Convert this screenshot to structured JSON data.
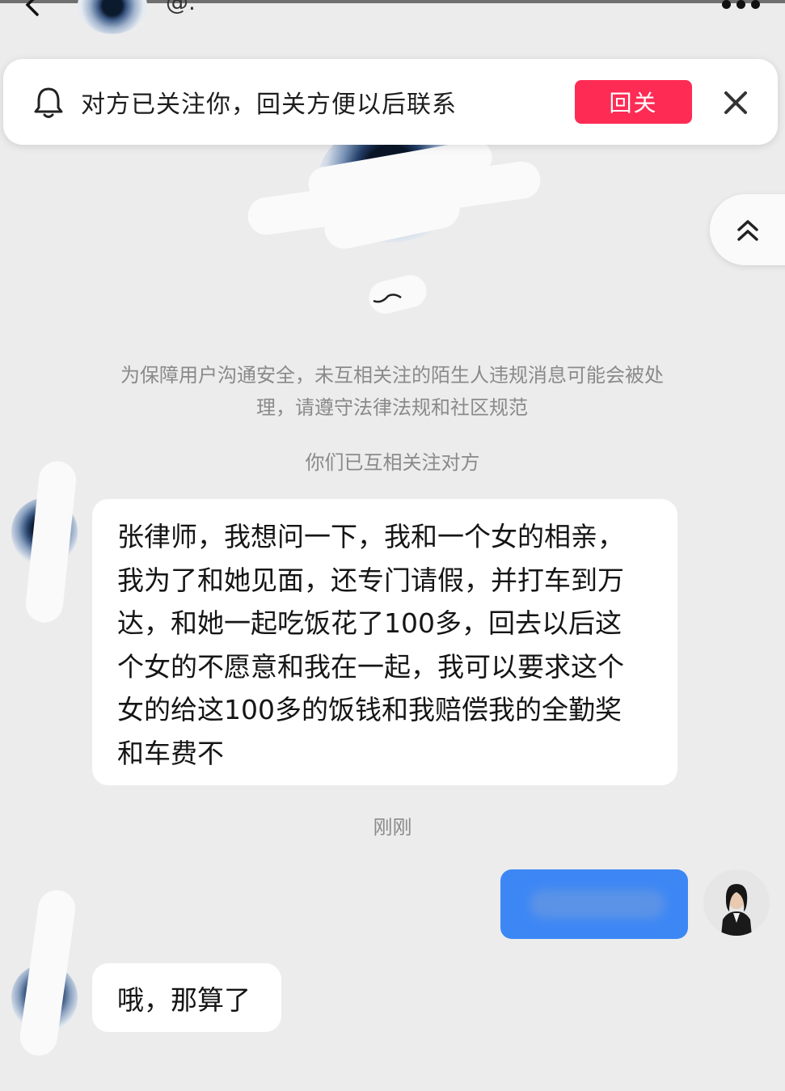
{
  "header": {
    "handle": "@."
  },
  "follow_banner": {
    "text": "对方已关注你，回关方便以后联系",
    "button_label": "回关"
  },
  "notices": {
    "safety_line1": "为保障用户沟通安全，未互相关注的陌生人违规消息可能会被处",
    "safety_line2": "理，请遵守法律法规和社区规范",
    "mutual_follow": "你们已互相关注对方"
  },
  "messages": [
    {
      "sender": "peer",
      "lines": [
        "张律师，我想问一下，我和一个女的相亲，",
        "我为了和她见面，还专门请假，并打车到万",
        "达，和她一起吃饭花了100多，回去以后这",
        "个女的不愿意和我在一起，我可以要求这个",
        "女的给这100多的饭钱和我赔偿我的全勤奖",
        "和车费不"
      ]
    },
    {
      "sender": "system",
      "timestamp": "刚刚"
    },
    {
      "sender": "me"
    },
    {
      "sender": "peer",
      "text": "哦，那算了"
    }
  ],
  "colors": {
    "background": "#ececec",
    "follow_button": "#fe2c55",
    "my_bubble": "#3d87f5",
    "notice_text": "#8a8a8a"
  }
}
